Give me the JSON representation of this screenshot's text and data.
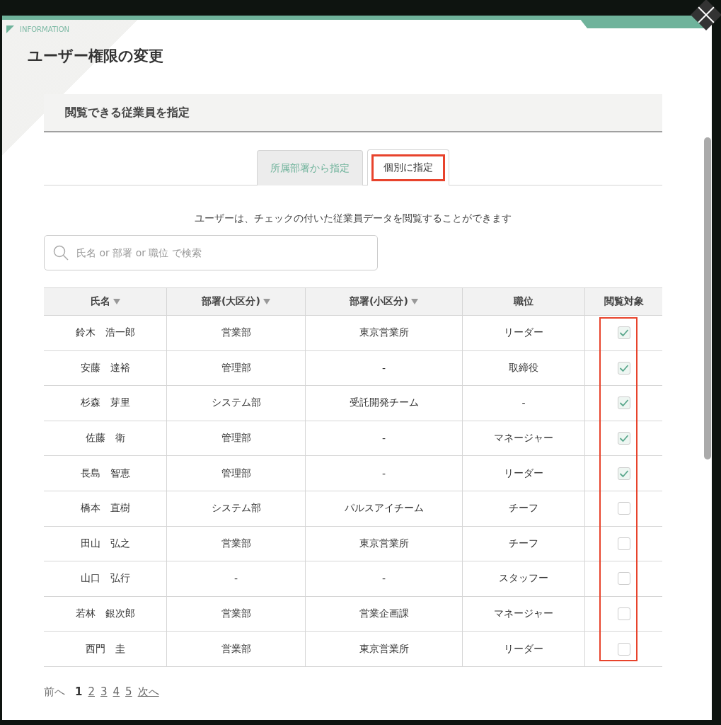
{
  "dialog": {
    "label": "INFORMATION",
    "title": "ユーザー権限の変更"
  },
  "section": {
    "title": "閲覧できる従業員を指定"
  },
  "tabs": [
    {
      "label": "所属部署から指定",
      "selected": false,
      "highlighted": false
    },
    {
      "label": "個別に指定",
      "selected": true,
      "highlighted": true
    }
  ],
  "notice": "ユーザーは、チェックの付いた従業員データを閲覧することができます",
  "search": {
    "placeholder": "氏名 or 部署 or 職位 で検索"
  },
  "table": {
    "columns": [
      {
        "label": "氏名",
        "sortable": true
      },
      {
        "label": "部署(大区分)",
        "sortable": true
      },
      {
        "label": "部署(小区分)",
        "sortable": true
      },
      {
        "label": "職位",
        "sortable": false
      },
      {
        "label": "閲覧対象",
        "sortable": false
      }
    ],
    "check_column_highlighted": true,
    "rows": [
      {
        "name": "鈴木　浩一郎",
        "dept_major": "営業部",
        "dept_minor": "東京営業所",
        "position": "リーダー",
        "checked": true
      },
      {
        "name": "安藤　達裕",
        "dept_major": "管理部",
        "dept_minor": "-",
        "position": "取締役",
        "checked": true
      },
      {
        "name": "杉森　芽里",
        "dept_major": "システム部",
        "dept_minor": "受託開発チーム",
        "position": "-",
        "checked": true
      },
      {
        "name": "佐藤　衛",
        "dept_major": "管理部",
        "dept_minor": "-",
        "position": "マネージャー",
        "checked": true
      },
      {
        "name": "長島　智恵",
        "dept_major": "管理部",
        "dept_minor": "-",
        "position": "リーダー",
        "checked": true
      },
      {
        "name": "橋本　直樹",
        "dept_major": "システム部",
        "dept_minor": "パルスアイチーム",
        "position": "チーフ",
        "checked": false
      },
      {
        "name": "田山　弘之",
        "dept_major": "営業部",
        "dept_minor": "東京営業所",
        "position": "チーフ",
        "checked": false
      },
      {
        "name": "山口　弘行",
        "dept_major": "-",
        "dept_minor": "-",
        "position": "スタッフー",
        "checked": false
      },
      {
        "name": "若林　銀次郎",
        "dept_major": "営業部",
        "dept_minor": "営業企画課",
        "position": "マネージャー",
        "checked": false
      },
      {
        "name": "西門　圭",
        "dept_major": "営業部",
        "dept_minor": "東京営業所",
        "position": "リーダー",
        "checked": false
      }
    ]
  },
  "pagination": {
    "prev": {
      "label": "前へ",
      "disabled": true
    },
    "pages": [
      {
        "label": "1",
        "selected": true
      },
      {
        "label": "2",
        "selected": false
      },
      {
        "label": "3",
        "selected": false
      },
      {
        "label": "4",
        "selected": false
      },
      {
        "label": "5",
        "selected": false
      }
    ],
    "next": {
      "label": "次へ",
      "disabled": false
    }
  }
}
